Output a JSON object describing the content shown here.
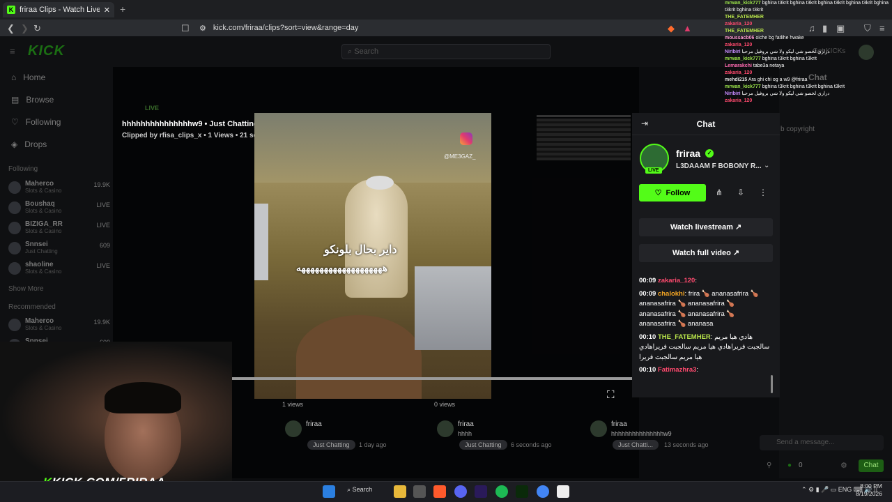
{
  "browser": {
    "tab_title": "friraa Clips - Watch Live on Ki",
    "url": "kick.com/friraa/clips?sort=view&range=day"
  },
  "site": {
    "logo": "KICK",
    "search_placeholder": "Search",
    "nav": [
      "Home",
      "Browse",
      "Following",
      "Drops"
    ],
    "following_label": "Following",
    "following": [
      {
        "name": "Maherco",
        "cat": "Slots & Casino",
        "val": "19.9K"
      },
      {
        "name": "Boushaq",
        "cat": "Slots & Casino",
        "val": "LIVE"
      },
      {
        "name": "BIZIGA_RR",
        "cat": "Slots & Casino",
        "val": "LIVE"
      },
      {
        "name": "Snnsei",
        "cat": "Just Chatting",
        "val": "609"
      },
      {
        "name": "shaoline",
        "cat": "Slots & Casino",
        "val": "LIVE"
      }
    ],
    "show_more": "Show More",
    "recommended_label": "Recommended",
    "recommended": [
      {
        "name": "Maherco",
        "cat": "Slots & Casino",
        "val": "19.9K"
      },
      {
        "name": "Snnsei",
        "cat": "",
        "val": "609"
      }
    ],
    "get_kicks": "Get KICKs",
    "right_chat_title": "Chat",
    "right_copyright": "b copyright",
    "send_placeholder": "Send a message...",
    "chat_button": "Chat",
    "right_counter": "0",
    "bg_live": "LIVE"
  },
  "clip": {
    "title": "hhhhhhhhhhhhhhhw9 • Just Chatting",
    "subtitle": "Clipped by rfisa_clips_x • 1 Views • 21 seconds ago",
    "caption_line1": "داير بحال بلونكو",
    "caption_line2": "هههههههههههههههههههه",
    "watermark": "@ME3GAZ_"
  },
  "chat_panel": {
    "header": "Chat",
    "channel": "friraa",
    "live": "LIVE",
    "stream_title": "L3DAAAM F BOBONY R...",
    "follow": "Follow",
    "watch_livestream": "Watch livestream",
    "watch_full_video": "Watch full video",
    "messages": [
      {
        "time": "00:09",
        "user": "zakaria_120",
        "color": "#ff4a6e",
        "text": ""
      },
      {
        "time": "00:09",
        "user": "chalokhi",
        "color": "#f5a623",
        "text": "frira 🍗 ananasafrira 🍗 ananasafrira 🍗 ananasafrira 🍗 ananasafrira 🍗 ananasafrira 🍗 ananasafrira 🍗 ananasa"
      },
      {
        "time": "00:10",
        "user": "THE_FATEMHER",
        "color": "#b7e34a",
        "text": "هادي هيا مريم سالجبت فريراهادي هيا مريم سالجبت فريراهادي هيا مريم سالجبت فريرا"
      },
      {
        "time": "00:10",
        "user": "Fatimazhra3",
        "color": "#ff4a6e",
        "text": ""
      }
    ]
  },
  "related": [
    {
      "views": "1 views",
      "name": "friraa",
      "title": "",
      "tag": "Just Chatting",
      "ago": "1 day ago"
    },
    {
      "views": "0 views",
      "name": "friraa",
      "title": "hhhh",
      "tag": "Just Chatting",
      "ago": "6 seconds ago"
    },
    {
      "views": "",
      "name": "friraa",
      "title": "hhhhhhhhhhhhhhhw9",
      "tag": "Just Chatti...",
      "ago": "13 seconds ago"
    }
  ],
  "overlay_chat": [
    {
      "user": "mrwan_kick777",
      "color": "#9be34a",
      "text": "bghina t3krit bghina t3krit bghina t3krit bghina t3krit bghina t3krit bghina t3krit"
    },
    {
      "user": "THE_FATEMHER",
      "color": "#b7e34a",
      "text": ""
    },
    {
      "user": "zakaria_120",
      "color": "#ff4a6e",
      "text": ""
    },
    {
      "user": "THE_FATEMHER",
      "color": "#b7e34a",
      "text": ""
    },
    {
      "user": "moussacb06",
      "color": "#ff9ad5",
      "text": "oiche bg fatlihe hwake"
    },
    {
      "user": "zakaria_120",
      "color": "#ff4a6e",
      "text": ""
    },
    {
      "user": "Niribiri",
      "color": "#c78cff",
      "text": "دراري لخصو شي ليكو ولا شي بروفيل مرحبا"
    },
    {
      "user": "mrwan_kick777",
      "color": "#9be34a",
      "text": "bghina t3krit bghina t3krit"
    },
    {
      "user": "Lemarakchi",
      "color": "#ff6ab0",
      "text": "tabe3a netaya"
    },
    {
      "user": "zakaria_120",
      "color": "#ff4a6e",
      "text": ""
    },
    {
      "user": "mehdi215",
      "color": "#e0e0e0",
      "text": "Ara ghi chi og a w9 @friraa"
    },
    {
      "user": "mrwan_kick777",
      "color": "#9be34a",
      "text": "bghina t3krit bghina t3krit bghina t3krit"
    },
    {
      "user": "Niribiri",
      "color": "#c78cff",
      "text": "دراري لخصو شي ليكو ولا شي بروفيل مرحبا"
    },
    {
      "user": "zakaria_120",
      "color": "#ff4a6e",
      "text": ""
    }
  ],
  "stream_brand": {
    "k": "K",
    "rest": "KICK.COM/FRIRAA"
  },
  "taskbar": {
    "search": "Search",
    "lang": "ENG",
    "time": "8:00 PM",
    "date": "8/19/2026"
  }
}
